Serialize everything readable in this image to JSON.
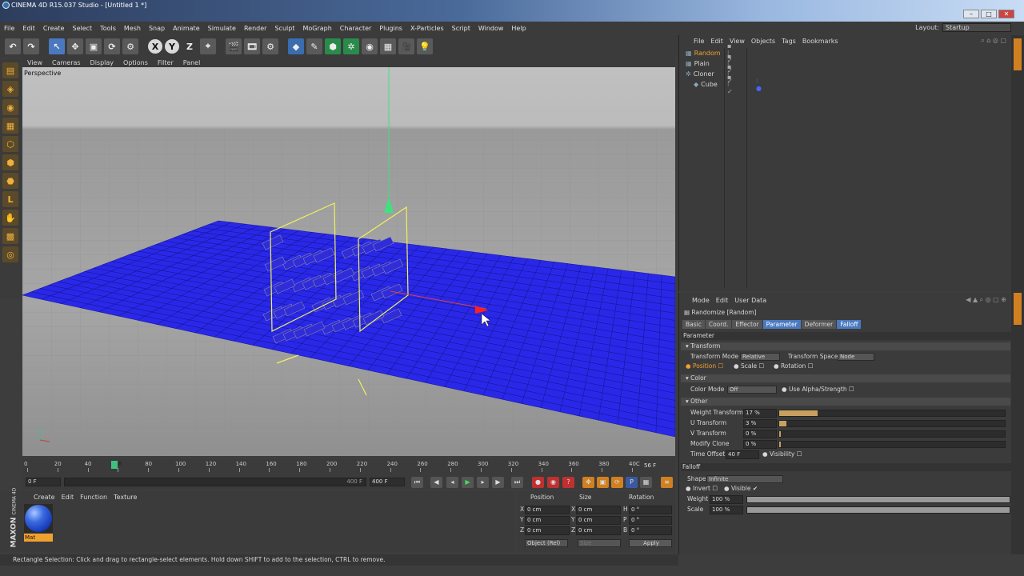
{
  "title_bar": {
    "text": "CINEMA 4D R15.037 Studio - [Untitled 1 *]"
  },
  "menu": [
    "File",
    "Edit",
    "Create",
    "Select",
    "Tools",
    "Mesh",
    "Snap",
    "Animate",
    "Simulate",
    "Render",
    "Sculpt",
    "MoGraph",
    "Character",
    "Plugins",
    "X-Particles",
    "Script",
    "Window",
    "Help"
  ],
  "layout": {
    "label": "Layout:",
    "value": "Startup"
  },
  "viewport_menu": [
    "View",
    "Cameras",
    "Display",
    "Options",
    "Filter",
    "Panel"
  ],
  "viewport": {
    "label": "Perspective"
  },
  "timeline": {
    "ticks": [
      "0",
      "20",
      "40",
      "56",
      "80",
      "100",
      "120",
      "140",
      "160",
      "180",
      "200",
      "220",
      "240",
      "260",
      "280",
      "300",
      "320",
      "340",
      "360",
      "380",
      "40C"
    ],
    "current": "56 F",
    "frame_field": "0 F",
    "end_field": "400 F",
    "end_field2": "400 F"
  },
  "material_menu": [
    "Create",
    "Edit",
    "Function",
    "Texture"
  ],
  "material": {
    "name": "Mat"
  },
  "maxon": {
    "brand": "MAXON",
    "product": "CINEMA 4D"
  },
  "coords": {
    "headers": [
      "Position",
      "Size",
      "Rotation"
    ],
    "rows": [
      {
        "a": "X",
        "pv": "0 cm",
        "b": "X",
        "sv": "0 cm",
        "c": "H",
        "rv": "0 °"
      },
      {
        "a": "Y",
        "pv": "0 cm",
        "b": "Y",
        "sv": "0 cm",
        "c": "P",
        "rv": "0 °"
      },
      {
        "a": "Z",
        "pv": "0 cm",
        "b": "Z",
        "sv": "0 cm",
        "c": "B",
        "rv": "0 °"
      }
    ],
    "mode": "Object (Rel)",
    "size_mode": "Size",
    "apply": "Apply"
  },
  "status": "Rectangle Selection: Click and drag to rectangle-select elements. Hold down SHIFT to add to the selection, CTRL to remove.",
  "objects_menu": [
    "File",
    "Edit",
    "View",
    "Objects",
    "Tags",
    "Bookmarks"
  ],
  "objects": [
    {
      "name": "Random",
      "color": "#f0a030"
    },
    {
      "name": "Plain",
      "color": "#d6d6d6"
    },
    {
      "name": "Cloner",
      "color": "#d6d6d6"
    },
    {
      "name": "Cube",
      "color": "#d6d6d6"
    }
  ],
  "attr_menu": [
    "Mode",
    "Edit",
    "User Data"
  ],
  "attr": {
    "title": "Randomize [Random]",
    "tabs": [
      {
        "label": "Basic",
        "on": false
      },
      {
        "label": "Coord.",
        "on": false
      },
      {
        "label": "Effector",
        "on": false
      },
      {
        "label": "Parameter",
        "on": true
      },
      {
        "label": "Deformer",
        "on": false
      },
      {
        "label": "Falloff",
        "on": true
      }
    ],
    "section_parameter": "Parameter",
    "transform": {
      "header": "Transform",
      "mode_label": "Transform Mode",
      "mode_value": "Relative",
      "space_label": "Transform Space",
      "space_value": "Node",
      "position": "Position",
      "scale": "Scale",
      "rotation": "Rotation"
    },
    "color": {
      "header": "Color",
      "mode_label": "Color Mode",
      "mode_value": "Off",
      "alpha_label": "Use Alpha/Strength"
    },
    "other": {
      "header": "Other",
      "rows": [
        {
          "label": "Weight Transform",
          "value": "17 %",
          "level": 0.17
        },
        {
          "label": "U Transform",
          "value": "3 %",
          "level": 0.03
        },
        {
          "label": "V Transform",
          "value": "0 %",
          "level": 0
        },
        {
          "label": "Modify Clone",
          "value": "0 %",
          "level": 0
        }
      ],
      "time_offset_label": "Time Offset",
      "time_offset_value": "40 F",
      "visibility": "Visibility"
    },
    "falloff": {
      "header": "Falloff",
      "shape_label": "Shape",
      "shape_value": "Infinite",
      "invert": "Invert",
      "visible": "Visible",
      "weight_label": "Weight",
      "weight_value": "100 %",
      "scale_label": "Scale",
      "scale_value": "100 %"
    }
  },
  "colors": {
    "accent": "#4a79c0",
    "clone": "#2a28e8",
    "highlight": "#f0a030"
  }
}
